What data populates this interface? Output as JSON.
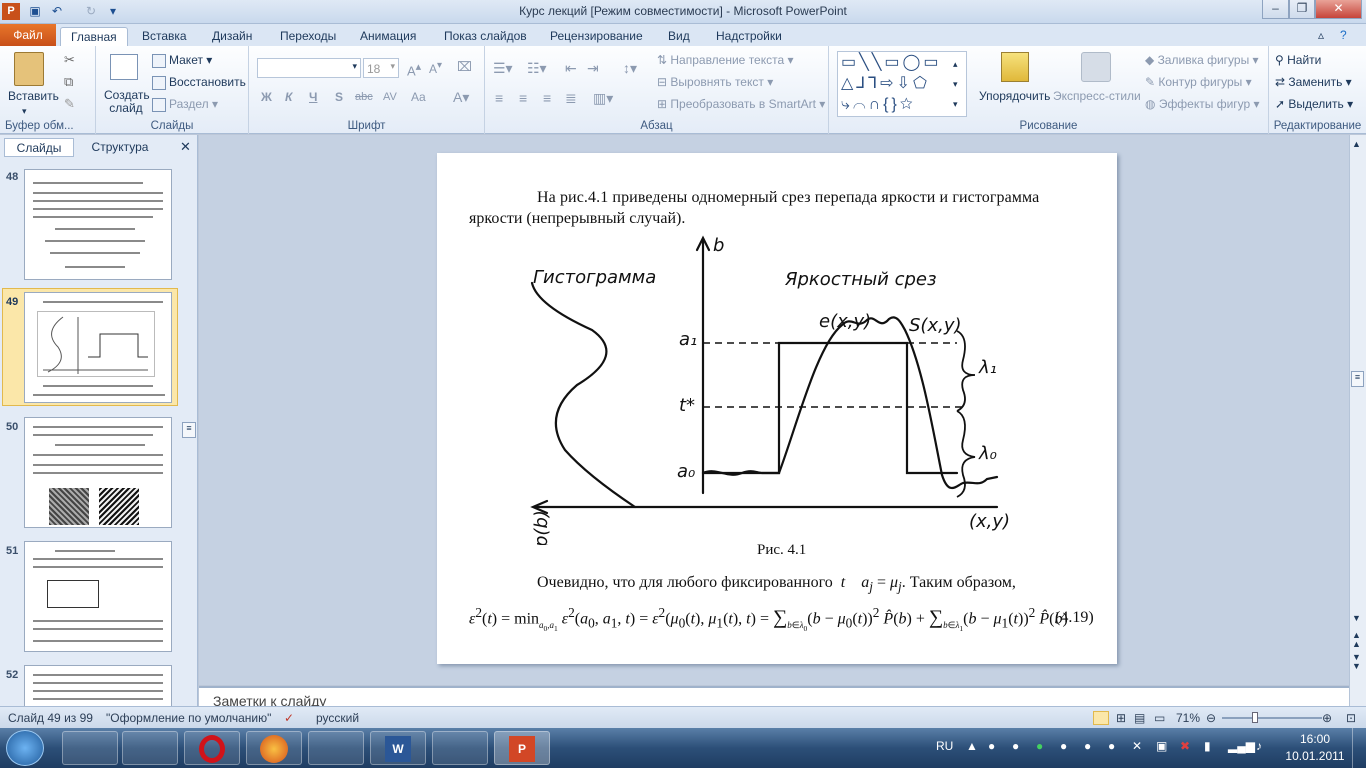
{
  "window": {
    "title": "Курс лекций [Режим совместимости]  -  Microsoft PowerPoint"
  },
  "tabs": [
    "Файл",
    "Главная",
    "Вставка",
    "Дизайн",
    "Переходы",
    "Анимация",
    "Показ слайдов",
    "Рецензирование",
    "Вид",
    "Надстройки"
  ],
  "ribbon": {
    "clipboard": {
      "label": "Буфер обм...",
      "paste": "Вставить"
    },
    "slides": {
      "label": "Слайды",
      "new_slide": "Создать слайд",
      "layout": "Макет",
      "reset": "Восстановить",
      "section": "Раздел"
    },
    "font": {
      "label": "Шрифт",
      "size": "18",
      "bold": "Ж",
      "italic": "К",
      "underline": "Ч",
      "shadow": "S",
      "strike": "abc",
      "spacing": "AV",
      "case": "Aa"
    },
    "paragraph": {
      "label": "Абзац",
      "text_direction": "Направление текста",
      "align_text": "Выровнять текст",
      "smartart": "Преобразовать в SmartArt"
    },
    "drawing": {
      "label": "Рисование",
      "arrange": "Упорядочить",
      "quick_styles": "Экспресс-стили",
      "fill": "Заливка фигуры",
      "outline": "Контур фигуры",
      "effects": "Эффекты фигур"
    },
    "editing": {
      "label": "Редактирование",
      "find": "Найти",
      "replace": "Заменить",
      "select": "Выделить"
    }
  },
  "pane": {
    "tab_slides": "Слайды",
    "tab_outline": "Структура",
    "slide_numbers": [
      "48",
      "49",
      "50",
      "51",
      "52"
    ]
  },
  "slide": {
    "para1": "На рис.4.1 приведены одномерный срез перепада яркости и гистограмма",
    "para1b": "яркости (непрерывный  случай).",
    "fig_caption": "Рис. 4.1",
    "para2": "Очевидно, что для любого фиксированного",
    "para2_t": "t",
    "para2_eq": "a",
    "para2_rest": ". Таким  образом,",
    "eq_number": "(4.19)",
    "fig": {
      "hist_label": "Гистограмма",
      "profile_label": "Яркостный срез",
      "b": "b",
      "a1": "a₁",
      "a0": "a₀",
      "tstar": "t*",
      "e": "e(x,y)",
      "s": "S(x,y)",
      "l1": "λ₁",
      "l0": "λ₀",
      "p": "p(b)",
      "xy": "(x,y)"
    }
  },
  "notes": {
    "placeholder": "Заметки к слайду"
  },
  "status": {
    "slide": "Слайд 49 из 99",
    "theme": "\"Оформление по умолчанию\"",
    "lang": "русский",
    "zoom": "71%"
  },
  "tray": {
    "lang": "RU",
    "time": "16:00",
    "date": "10.01.2011"
  }
}
